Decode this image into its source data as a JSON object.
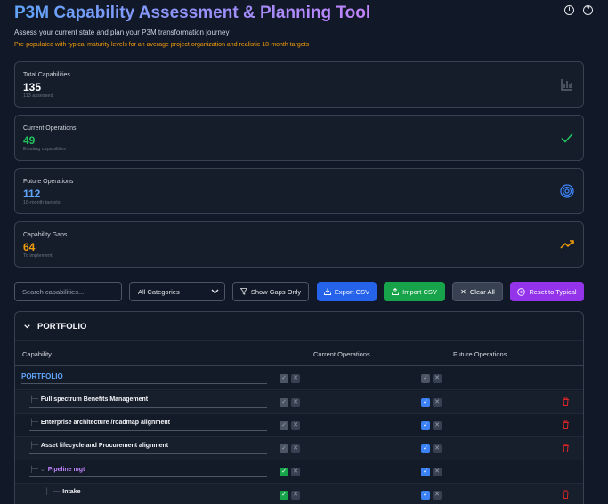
{
  "header": {
    "title": "P3M Capability Assessment & Planning Tool",
    "subtitle": "Assess your current state and plan your P3M transformation journey",
    "note": "Pre-populated with typical maturity levels for an average project organization and realistic 18-month targets",
    "icons": [
      "info-icon",
      "help-icon"
    ]
  },
  "cards": [
    {
      "label": "Total Capabilities",
      "value": "135",
      "sub": "113 assessed",
      "color": "#ffffff",
      "icon": "bar-chart-icon"
    },
    {
      "label": "Current Operations",
      "value": "49",
      "sub": "Existing capabilities",
      "color": "#22c55e",
      "icon": "check-icon"
    },
    {
      "label": "Future Operations",
      "value": "112",
      "sub": "18-month targets",
      "color": "#60a5fa",
      "icon": "target-icon"
    },
    {
      "label": "Capability Gaps",
      "value": "64",
      "sub": "To implement",
      "color": "#f59e0b",
      "icon": "trending-up-icon"
    }
  ],
  "toolbar": {
    "search_placeholder": "Search capabilities...",
    "category_value": "All Categories",
    "show_gaps": "Show Gaps Only",
    "export": "Export CSV",
    "import": "Import CSV",
    "clear": "Clear All",
    "reset": "Reset to Typical"
  },
  "panel": {
    "title": "PORTFOLIO",
    "columns": [
      "Capability",
      "Current Operations",
      "Future Operations"
    ],
    "rows": [
      {
        "name": "PORTFOLIO",
        "tree": "",
        "current": false,
        "future": false
      },
      {
        "name": "Full spectrum Benefits Management",
        "tree": "├─",
        "current": false,
        "future": true
      },
      {
        "name": "Enterprise architecture /roadmap alignment",
        "tree": "├─",
        "current": false,
        "future": true
      },
      {
        "name": "Asset lifecycle and Procurement alignment",
        "tree": "├─",
        "current": false,
        "future": true
      },
      {
        "name": "Pipeline mgt",
        "tree": "├─ ⌄",
        "current": true,
        "future": true
      },
      {
        "name": "Intake",
        "tree": "│ └─",
        "current": true,
        "future": true
      }
    ]
  }
}
